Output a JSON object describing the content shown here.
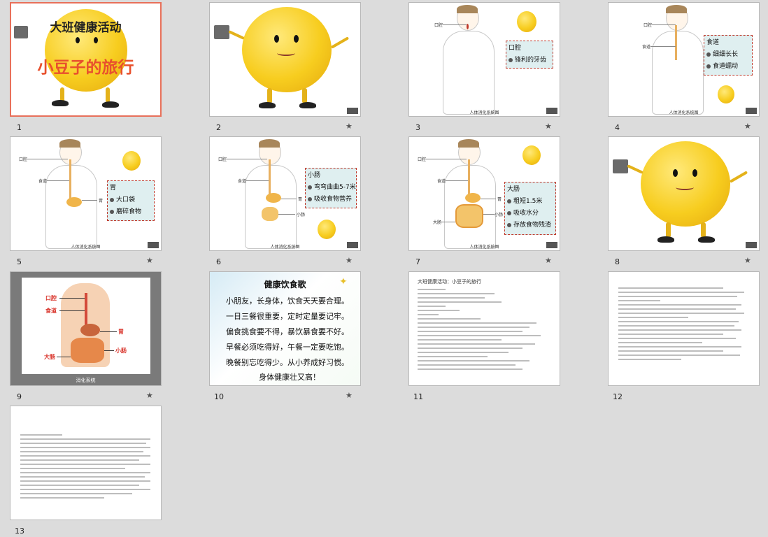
{
  "slides": [
    {
      "num": "1",
      "title": "大班健康活动",
      "subtitle": "小豆子的旅行"
    },
    {
      "num": "2"
    },
    {
      "num": "3",
      "caption": "人体消化系统图",
      "label_mouth": "口腔",
      "box": [
        "口腔",
        "锋利的牙齿"
      ]
    },
    {
      "num": "4",
      "caption": "人体消化系统图",
      "label_mouth": "口腔",
      "label_esoph": "食道",
      "box": [
        "食道",
        "细细长长",
        "食道蠕动"
      ]
    },
    {
      "num": "5",
      "caption": "人体消化系统图",
      "label_mouth": "口腔",
      "label_esoph": "食道",
      "label_stomach": "胃",
      "box": [
        "胃",
        "大口袋",
        "磨碎食物"
      ]
    },
    {
      "num": "6",
      "caption": "人体消化系统图",
      "label_mouth": "口腔",
      "label_esoph": "食道",
      "label_stomach": "胃",
      "label_small": "小肠",
      "box": [
        "小肠",
        "弯弯曲曲5-7米",
        "吸收食物营养"
      ]
    },
    {
      "num": "7",
      "caption": "人体消化系统图",
      "label_mouth": "口腔",
      "label_esoph": "食道",
      "label_stomach": "胃",
      "label_small": "小肠",
      "label_large": "大肠",
      "box": [
        "大肠",
        "粗短1.5米",
        "吸收水分",
        "存放食物残渣"
      ]
    },
    {
      "num": "8"
    },
    {
      "num": "9",
      "labels": [
        "口腔",
        "食道",
        "胃",
        "小肠",
        "大肠"
      ],
      "caption": "消化系统"
    },
    {
      "num": "10",
      "title": "健康饮食歌",
      "lines": [
        "小朋友，长身体，饮食天天要合理。",
        "一日三餐很重要，定时定量要记牢。",
        "偏食挑食要不得，暴饮暴食要不好。",
        "早餐必须吃得好，午餐一定要吃饱。",
        "晚餐别忘吃得少。从小养成好习惯。",
        "身体健康壮又高！"
      ]
    },
    {
      "num": "11",
      "title": "大班健康活动：小豆子的旅行"
    },
    {
      "num": "12"
    },
    {
      "num": "13"
    }
  ],
  "star_icon": "★"
}
